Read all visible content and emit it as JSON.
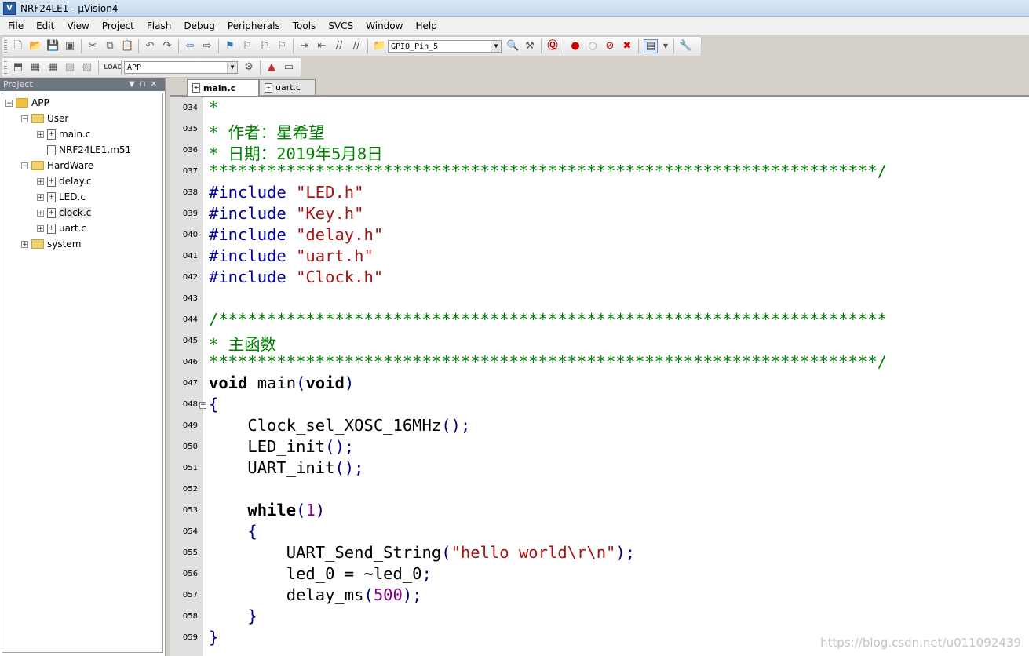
{
  "window": {
    "title": "NRF24LE1 - µVision4"
  },
  "menu": [
    "File",
    "Edit",
    "View",
    "Project",
    "Flash",
    "Debug",
    "Peripherals",
    "Tools",
    "SVCS",
    "Window",
    "Help"
  ],
  "toolbar": {
    "find_combo": "GPIO_Pin_5",
    "target_combo": "APP"
  },
  "project_pane": {
    "title": "Project",
    "tree": [
      {
        "label": "APP",
        "type": "root"
      },
      {
        "label": "User",
        "type": "folder"
      },
      {
        "label": "main.c",
        "type": "file"
      },
      {
        "label": "NRF24LE1.m51",
        "type": "file"
      },
      {
        "label": "HardWare",
        "type": "folder"
      },
      {
        "label": "delay.c",
        "type": "file"
      },
      {
        "label": "LED.c",
        "type": "file"
      },
      {
        "label": "clock.c",
        "type": "file"
      },
      {
        "label": "uart.c",
        "type": "file"
      },
      {
        "label": "system",
        "type": "folder"
      }
    ]
  },
  "tabs": [
    {
      "label": "main.c",
      "active": true
    },
    {
      "label": "uart.c",
      "active": false
    }
  ],
  "editor": {
    "lines": [
      {
        "num": "034",
        "tokens": [
          {
            "t": "*",
            "c": "comment"
          }
        ]
      },
      {
        "num": "035",
        "tokens": [
          {
            "t": "* 作者：星希望",
            "c": "comment"
          }
        ]
      },
      {
        "num": "036",
        "tokens": [
          {
            "t": "* 日期：2019年5月8日",
            "c": "comment"
          }
        ]
      },
      {
        "num": "037",
        "tokens": [
          {
            "t": "*********************************************************************/",
            "c": "comment"
          }
        ]
      },
      {
        "num": "038",
        "tokens": [
          {
            "t": "#include ",
            "c": "pre"
          },
          {
            "t": "\"LED.h\"",
            "c": "str"
          }
        ]
      },
      {
        "num": "039",
        "tokens": [
          {
            "t": "#include ",
            "c": "pre"
          },
          {
            "t": "\"Key.h\"",
            "c": "str"
          }
        ]
      },
      {
        "num": "040",
        "tokens": [
          {
            "t": "#include ",
            "c": "pre"
          },
          {
            "t": "\"delay.h\"",
            "c": "str"
          }
        ]
      },
      {
        "num": "041",
        "tokens": [
          {
            "t": "#include ",
            "c": "pre"
          },
          {
            "t": "\"uart.h\"",
            "c": "str"
          }
        ]
      },
      {
        "num": "042",
        "tokens": [
          {
            "t": "#include ",
            "c": "pre"
          },
          {
            "t": "\"Clock.h\"",
            "c": "str"
          }
        ]
      },
      {
        "num": "043",
        "tokens": []
      },
      {
        "num": "044",
        "tokens": [
          {
            "t": "/*********************************************************************",
            "c": "comment"
          }
        ]
      },
      {
        "num": "045",
        "tokens": [
          {
            "t": "* 主函数",
            "c": "comment"
          }
        ]
      },
      {
        "num": "046",
        "tokens": [
          {
            "t": "*********************************************************************/",
            "c": "comment"
          }
        ]
      },
      {
        "num": "047",
        "tokens": [
          {
            "t": "void",
            "c": "kw"
          },
          {
            "t": " main",
            "c": ""
          },
          {
            "t": "(",
            "c": "punc"
          },
          {
            "t": "void",
            "c": "kw"
          },
          {
            "t": ")",
            "c": "punc"
          }
        ]
      },
      {
        "num": "048",
        "fold": true,
        "tokens": [
          {
            "t": "{",
            "c": "punc"
          }
        ]
      },
      {
        "num": "049",
        "tokens": [
          {
            "t": "    Clock_sel_XOSC_16MHz",
            "c": ""
          },
          {
            "t": "();",
            "c": "punc"
          }
        ]
      },
      {
        "num": "050",
        "tokens": [
          {
            "t": "    LED_init",
            "c": ""
          },
          {
            "t": "();",
            "c": "punc"
          }
        ]
      },
      {
        "num": "051",
        "tokens": [
          {
            "t": "    UART_init",
            "c": ""
          },
          {
            "t": "();",
            "c": "punc"
          }
        ]
      },
      {
        "num": "052",
        "tokens": []
      },
      {
        "num": "053",
        "tokens": [
          {
            "t": "    while",
            "c": "kw"
          },
          {
            "t": "(",
            "c": "punc"
          },
          {
            "t": "1",
            "c": "num"
          },
          {
            "t": ")",
            "c": "punc"
          }
        ]
      },
      {
        "num": "054",
        "tokens": [
          {
            "t": "    {",
            "c": "punc"
          }
        ]
      },
      {
        "num": "055",
        "tokens": [
          {
            "t": "        UART_Send_String",
            "c": ""
          },
          {
            "t": "(",
            "c": "punc"
          },
          {
            "t": "\"hello world\\r\\n\"",
            "c": "str"
          },
          {
            "t": ");",
            "c": "punc"
          }
        ]
      },
      {
        "num": "056",
        "tokens": [
          {
            "t": "        led_0 = ~led_0",
            "c": ""
          },
          {
            "t": ";",
            "c": "punc"
          }
        ]
      },
      {
        "num": "057",
        "tokens": [
          {
            "t": "        delay_ms",
            "c": ""
          },
          {
            "t": "(",
            "c": "punc"
          },
          {
            "t": "500",
            "c": "num"
          },
          {
            "t": ");",
            "c": "punc"
          }
        ]
      },
      {
        "num": "058",
        "tokens": [
          {
            "t": "    }",
            "c": "punc"
          }
        ]
      },
      {
        "num": "059",
        "tokens": [
          {
            "t": "}",
            "c": "punc"
          }
        ]
      }
    ]
  },
  "watermark": "https://blog.csdn.net/u011092439"
}
